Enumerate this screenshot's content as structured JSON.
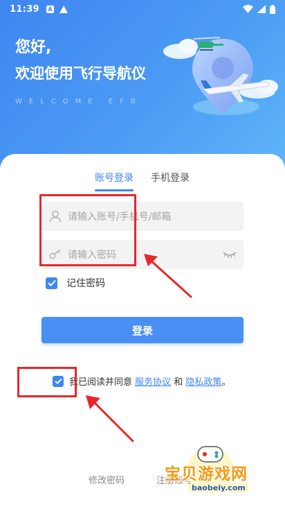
{
  "status_bar": {
    "time": "11:39",
    "box_icon_letter": "A"
  },
  "header": {
    "greeting": "您好,",
    "welcome": "欢迎使用飞行导航仪",
    "welcome_en": "WELCOME EFB"
  },
  "tabs": [
    {
      "label": "账号登录",
      "active": true
    },
    {
      "label": "手机登录",
      "active": false
    }
  ],
  "form": {
    "account_placeholder": "请输入账号/手机号/邮箱",
    "password_placeholder": "请输入密码",
    "remember_label": "记住密码",
    "remember_checked": true,
    "login_label": "登录"
  },
  "agreement": {
    "checked": true,
    "prefix": "我已阅读并同意 ",
    "service_link": "服务协议",
    "and": " 和 ",
    "privacy_link": "隐私政策",
    "suffix": "。"
  },
  "bottom_links": {
    "change_password": "修改密码",
    "register": "注册账号"
  },
  "watermark": {
    "title": "宝贝游戏网",
    "url": "baobeiy.com"
  },
  "colors": {
    "accent": "#3f86f0",
    "annotation_red": "#e8262b"
  },
  "icons": [
    "wifi-icon",
    "signal-icon",
    "battery-icon",
    "user-icon",
    "key-icon",
    "eye-closed-icon",
    "check-icon"
  ]
}
